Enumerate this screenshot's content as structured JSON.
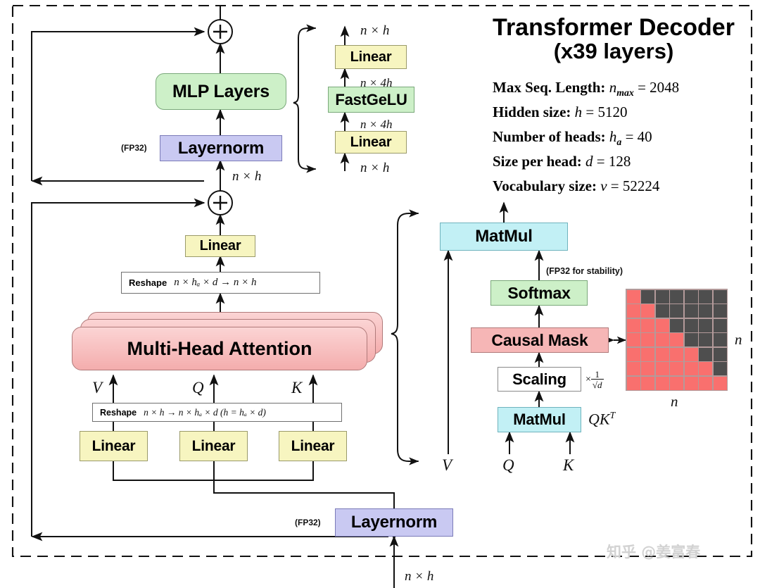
{
  "header": {
    "title_line1": "Transformer Decoder",
    "title_line2": "(x39 layers)"
  },
  "specs": [
    {
      "name": "max-seq-length",
      "label": "Max Seq. Length:",
      "var": "n",
      "sub": "max",
      "eq": "=",
      "value": "2048"
    },
    {
      "name": "hidden-size",
      "label": "Hidden size:",
      "var": "h",
      "sub": "",
      "eq": "=",
      "value": "5120"
    },
    {
      "name": "number-of-heads",
      "label": "Number of heads:",
      "var": "h",
      "sub": "a",
      "eq": "=",
      "value": "40"
    },
    {
      "name": "size-per-head",
      "label": "Size per head:",
      "var": "d",
      "sub": "",
      "eq": "=",
      "value": "128"
    },
    {
      "name": "vocabulary-size",
      "label": "Vocabulary size:",
      "var": "v",
      "sub": "",
      "eq": "=",
      "value": "52224"
    }
  ],
  "blocks": {
    "mlp_layers": "MLP Layers",
    "layernorm_mlp": "Layernorm",
    "layernorm_attn": "Layernorm",
    "linear_proj": "Linear",
    "linear_v": "Linear",
    "linear_q": "Linear",
    "linear_k": "Linear",
    "mlp_linear_up": "Linear",
    "mlp_linear_down": "Linear",
    "fastgelu": "FastGeLU",
    "multi_head_attention": "Multi-Head Attention",
    "matmul_out": "MatMul",
    "softmax": "Softmax",
    "causal_mask": "Causal Mask",
    "scaling": "Scaling",
    "matmul_qk": "MatMul"
  },
  "annotations": {
    "fp32_mlp": "(FP32)",
    "fp32_attn": "(FP32)",
    "fp32_stability": "(FP32 for stability)",
    "qkt": "QK",
    "qkt_sup": "T",
    "scaling_times": "×",
    "scaling_num": "1",
    "scaling_den": "√d"
  },
  "tensor_labels": {
    "mlp_in_nh": "n × h",
    "mlp_up_n4h": "n × 4h",
    "mlp_gelu_n4h": "n × 4h",
    "mlp_out_nh": "n × h",
    "residual_nh": "n × h",
    "bottom_input_nh": "n × h",
    "mask_rows": "n",
    "mask_cols": "n"
  },
  "qkv_labels": {
    "v": "V",
    "q": "Q",
    "k": "K"
  },
  "attn_inputs": {
    "v": "V",
    "q": "Q",
    "k": "K"
  },
  "reshape_top": {
    "word": "Reshape",
    "formula": "n × hₐ × d → n × h"
  },
  "reshape_bottom": {
    "word": "Reshape",
    "formula": "n × h → n × hₐ × d  (h = hₐ × d)"
  },
  "causal_mask_grid": {
    "rows": 7,
    "cols": 7,
    "pattern": "lower-triangular",
    "on_color": "#f9706e",
    "off_color": "#4e4e4e"
  },
  "watermark": {
    "text": "知乎 @姜富春"
  },
  "colors": {
    "yellow": "#f7f5c0",
    "green": "#cdf0c8",
    "purple": "#c9c9f2",
    "cyan": "#c2f0f5",
    "pink": "#f6b6b6",
    "mask_on": "#f9706e",
    "mask_off": "#4e4e4e"
  }
}
